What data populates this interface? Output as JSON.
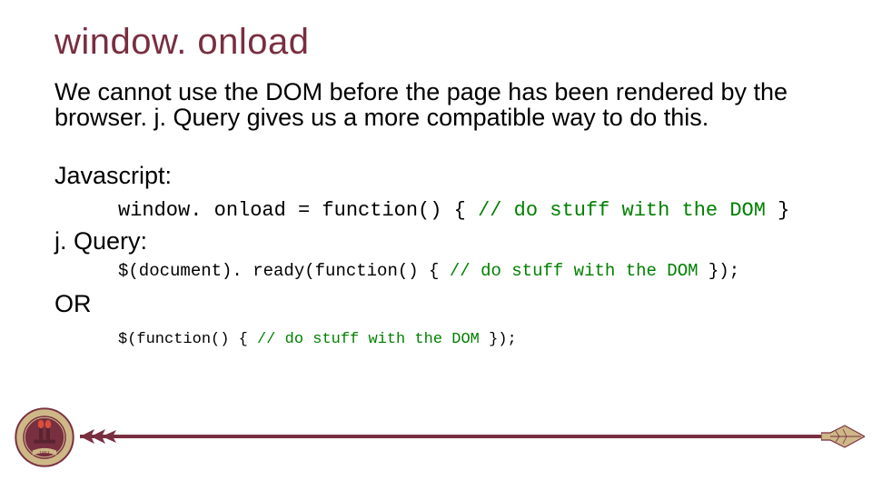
{
  "colors": {
    "garnet": "#782f40",
    "gold": "#ceb888",
    "comment_green": "#008000"
  },
  "title": "window. onload",
  "intro": "We cannot use the DOM before the page has been rendered by the browser. j. Query gives us a more compatible way to do this.",
  "js_label": "Javascript:",
  "code1_a": "window. onload = function() { ",
  "code1_comment": "// do stuff with the DOM ",
  "code1_b": "}",
  "jq_label": "j. Query:",
  "code2_a": "$(document). ready(function() { ",
  "code2_comment": "// do stuff with the DOM ",
  "code2_b": "});",
  "or_label": "OR",
  "code3_a": "$(function() { ",
  "code3_comment": "// do stuff with the DOM ",
  "code3_b": "});",
  "seal_year": "1851"
}
